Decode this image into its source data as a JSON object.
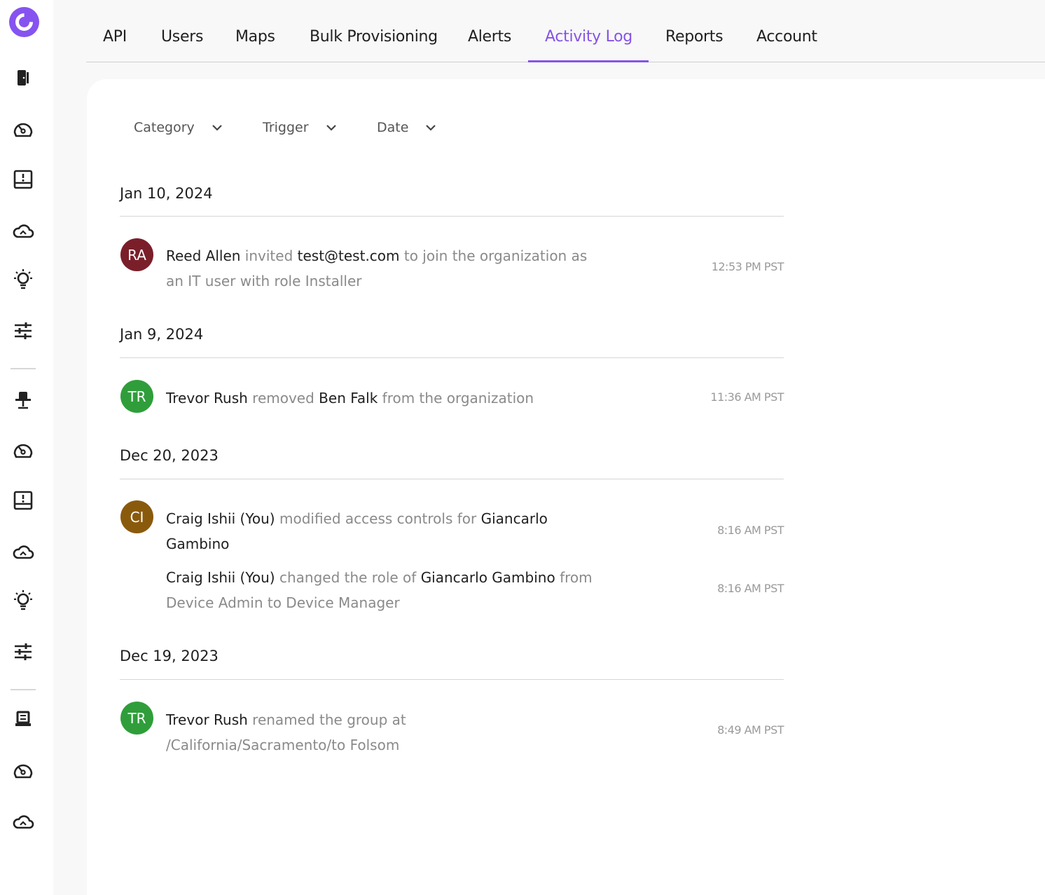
{
  "nav": {
    "tabs": [
      {
        "label": "API"
      },
      {
        "label": "Users"
      },
      {
        "label": "Maps"
      },
      {
        "label": "Bulk Provisioning"
      },
      {
        "label": "Alerts"
      },
      {
        "label": "Activity Log"
      },
      {
        "label": "Reports"
      },
      {
        "label": "Account"
      }
    ],
    "active_tab": "Activity Log"
  },
  "sidebar": {
    "icons": [
      "logo-icon",
      "door-icon",
      "gauge-icon",
      "alert-inbox-icon",
      "cloud-icon",
      "lightbulb-icon",
      "sliders-icon",
      "desk-chair-icon",
      "gauge-icon",
      "alert-inbox-icon",
      "cloud-icon",
      "lightbulb-icon",
      "sliders-icon",
      "laptop-icon",
      "gauge-icon",
      "cloud-icon"
    ]
  },
  "filters": {
    "category": "Category",
    "trigger": "Trigger",
    "date": "Date"
  },
  "colors": {
    "accent": "#8653e6",
    "avatar_ra": "#7a1f2a",
    "avatar_tr": "#2f9e3a",
    "avatar_ci": "#8a5a0c"
  },
  "log": {
    "groups": [
      {
        "date": "Jan 10, 2024",
        "entries": [
          {
            "initials": "RA",
            "actor": "Reed Allen",
            "verb": "invited",
            "object": "test@test.com",
            "rest": "to join the organization as an IT user with role Installer",
            "time": "12:53 PM PST"
          }
        ]
      },
      {
        "date": "Jan 9, 2024",
        "entries": [
          {
            "initials": "TR",
            "actor": "Trevor Rush",
            "verb": "removed",
            "object": "Ben Falk",
            "rest": "from the organization",
            "time": "11:36 AM PST"
          }
        ]
      },
      {
        "date": "Dec 20, 2023",
        "entries": [
          {
            "initials": "CI",
            "actor": "Craig Ishii (You)",
            "verb": "modified access controls for",
            "object": "Giancarlo Gambino",
            "time": "8:16 AM PST"
          },
          {
            "actor": "Craig Ishii (You)",
            "verb": "changed the role of",
            "object": "Giancarlo Gambino",
            "rest": "from Device Admin to Device Manager",
            "time": "8:16 AM PST"
          }
        ]
      },
      {
        "date": "Dec 19, 2023",
        "entries": [
          {
            "initials": "TR",
            "actor": "Trevor Rush",
            "verb": "renamed the group at",
            "rest": "/California/Sacramento/to Folsom",
            "time": "8:49 AM PST"
          }
        ]
      }
    ]
  }
}
